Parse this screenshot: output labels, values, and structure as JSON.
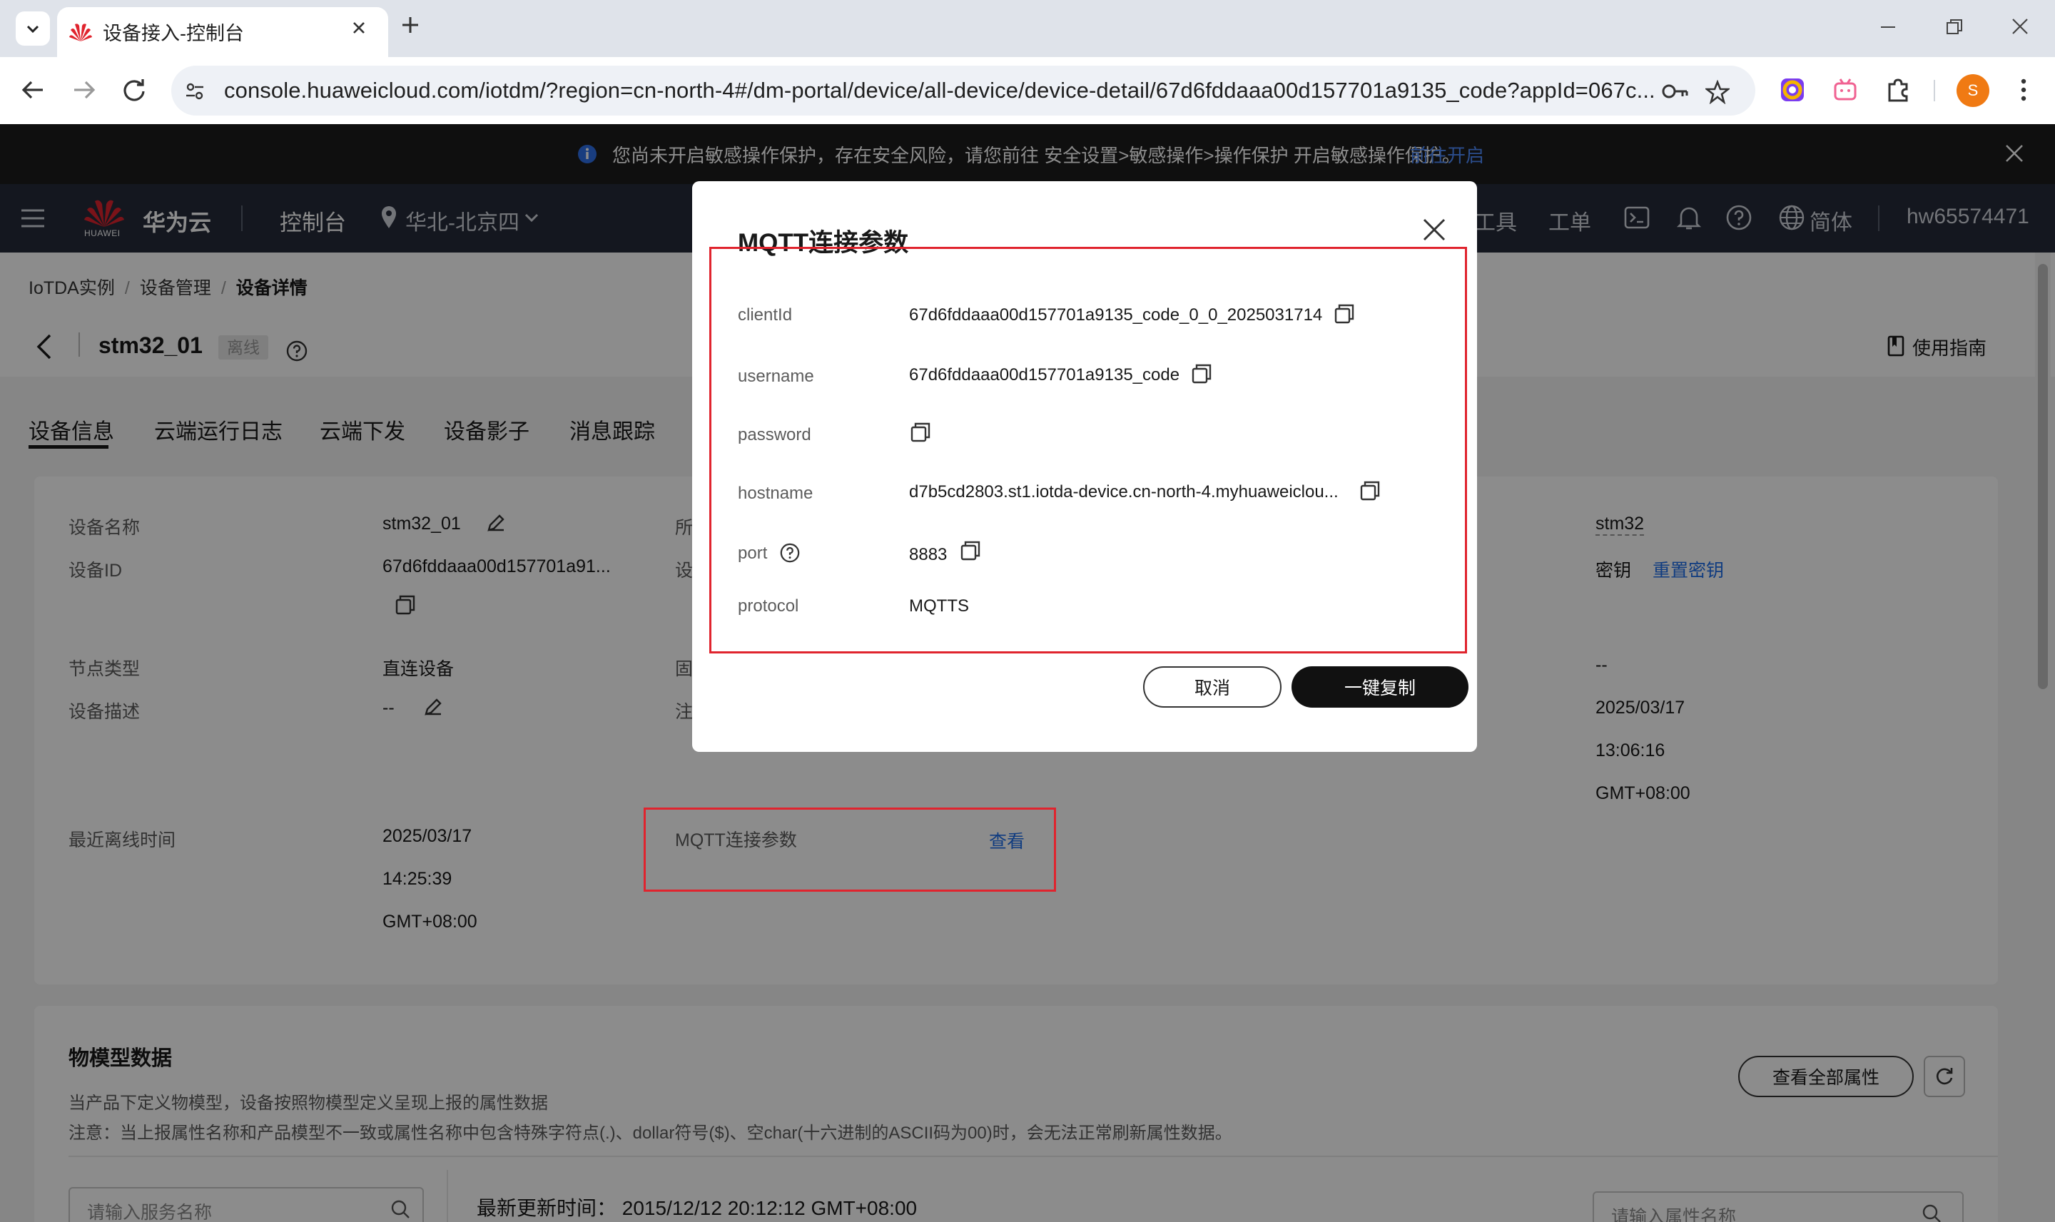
{
  "browser": {
    "tab_title": "设备接入-控制台",
    "url": "console.huaweicloud.com/iotdm/?region=cn-north-4#/dm-portal/device/all-device/device-detail/67d6fddaaa00d157701a9135_code?appId=067c...",
    "profile_initial": "S"
  },
  "notice": {
    "text": "您尚未开启敏感操作保护，存在安全风险，请您前往 安全设置>敏感操作>操作保护 开启敏感操作保护。",
    "link": "前往开启"
  },
  "topnav": {
    "brand": "华为云",
    "logo_text": "HUAWEI",
    "console": "控制台",
    "region": "华北-北京四",
    "tools": "工具",
    "ticket": "工单",
    "lang": "简体",
    "user": "hw65574471"
  },
  "breadcrumb": [
    "IoTDA实例",
    "设备管理",
    "设备详情"
  ],
  "device_header": {
    "name": "stm32_01",
    "status": "离线",
    "guide": "使用指南"
  },
  "tabs": [
    "设备信息",
    "云端运行日志",
    "云端下发",
    "设备影子",
    "消息跟踪"
  ],
  "info": {
    "name_label": "设备名称",
    "name_value": "stm32_01",
    "id_label": "设备ID",
    "id_value": "67d6fddaaa00d157701a91...",
    "node_label": "节点类型",
    "node_value": "直连设备",
    "desc_label": "设备描述",
    "desc_value": "--",
    "offline_label": "最近离线时间",
    "offline_date": "2025/03/17",
    "offline_time": "14:25:39",
    "offline_tz": "GMT+08:00",
    "mid_1": "所",
    "mid_2": "设",
    "mid_3": "固",
    "mid_4": "注",
    "mqtt_label": "MQTT连接参数",
    "mqtt_link": "查看",
    "right_product": "stm32",
    "right_secret_label": "密钥",
    "right_secret_link": "重置密钥",
    "right_dash": "--",
    "right_date": "2025/03/17",
    "right_time": "13:06:16",
    "right_tz": "GMT+08:00"
  },
  "tsl": {
    "title": "物模型数据",
    "desc1": "当产品下定义物模型，设备按照物模型定义呈现上报的属性数据",
    "desc2": "注意：当上报属性名称和产品模型不一致或属性名称中包含特殊字符点(.)、dollar符号($)、空char(十六进制的ASCII码为00)时，会无法正常刷新属性数据。",
    "view_all": "查看全部属性",
    "service_placeholder": "请输入服务名称",
    "last_update": "最新更新时间：  2015/12/12 20:12:12 GMT+08:00",
    "property_placeholder": "请输入属性名称"
  },
  "dialog": {
    "title": "MQTT连接参数",
    "params": [
      {
        "label": "clientId",
        "value": "67d6fddaaa00d157701a9135_code_0_0_2025031714"
      },
      {
        "label": "username",
        "value": "67d6fddaaa00d157701a9135_code"
      },
      {
        "label": "password",
        "value": ""
      },
      {
        "label": "hostname",
        "value": "d7b5cd2803.st1.iotda-device.cn-north-4.myhuaweiclou..."
      },
      {
        "label": "port",
        "value": "8883"
      },
      {
        "label": "protocol",
        "value": "MQTTS"
      }
    ],
    "cancel": "取消",
    "copy_all": "一键复制"
  },
  "colors": {
    "highlight_box": "#e0242e",
    "link": "#1e6dea",
    "topnav_bg": "#252b3a",
    "primary_button": "#111111"
  }
}
